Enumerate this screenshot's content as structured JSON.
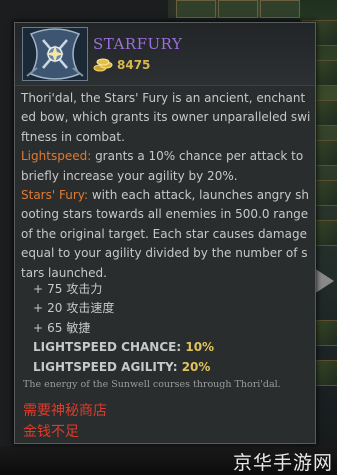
{
  "item": {
    "name": "STARFURY",
    "cost": "8475",
    "icon": "starfury-bow-icon"
  },
  "description": {
    "intro": "Thori'dal, the Stars' Fury is an ancient, enchanted bow, which grants its owner unparalleled swiftness in combat.",
    "ability1_name": "Lightspeed:",
    "ability1_text": " grants a 10% chance per attack to briefly increase your agility by 20%.",
    "ability2_name": "Stars' Fury:",
    "ability2_text": " with each attack, launches angry shooting stars towards all enemies in 500.0 range of the original target. Each star causes damage equal to your agility divided by the number of stars launched."
  },
  "stats": [
    {
      "plus": "+",
      "value": "75",
      "label": "攻击力"
    },
    {
      "plus": "+",
      "value": "20",
      "label": "攻击速度"
    },
    {
      "plus": "+",
      "value": "65",
      "label": "敏捷"
    }
  ],
  "specials": [
    {
      "label": "LIGHTSPEED CHANCE:",
      "value": "10%"
    },
    {
      "label": "LIGHTSPEED AGILITY:",
      "value": "20%"
    }
  ],
  "lore": "The energy of the Sunwell courses through Thori'dal.",
  "requirements": {
    "line1": "需要神秘商店",
    "line2": "金钱不足"
  },
  "watermark": "京华手游网",
  "colors": {
    "item_name": "#9a6fd9",
    "cost": "#d8b84a",
    "ability_name": "#e07a33",
    "special_value": "#e0c45a",
    "requirement": "#e03a2a"
  }
}
